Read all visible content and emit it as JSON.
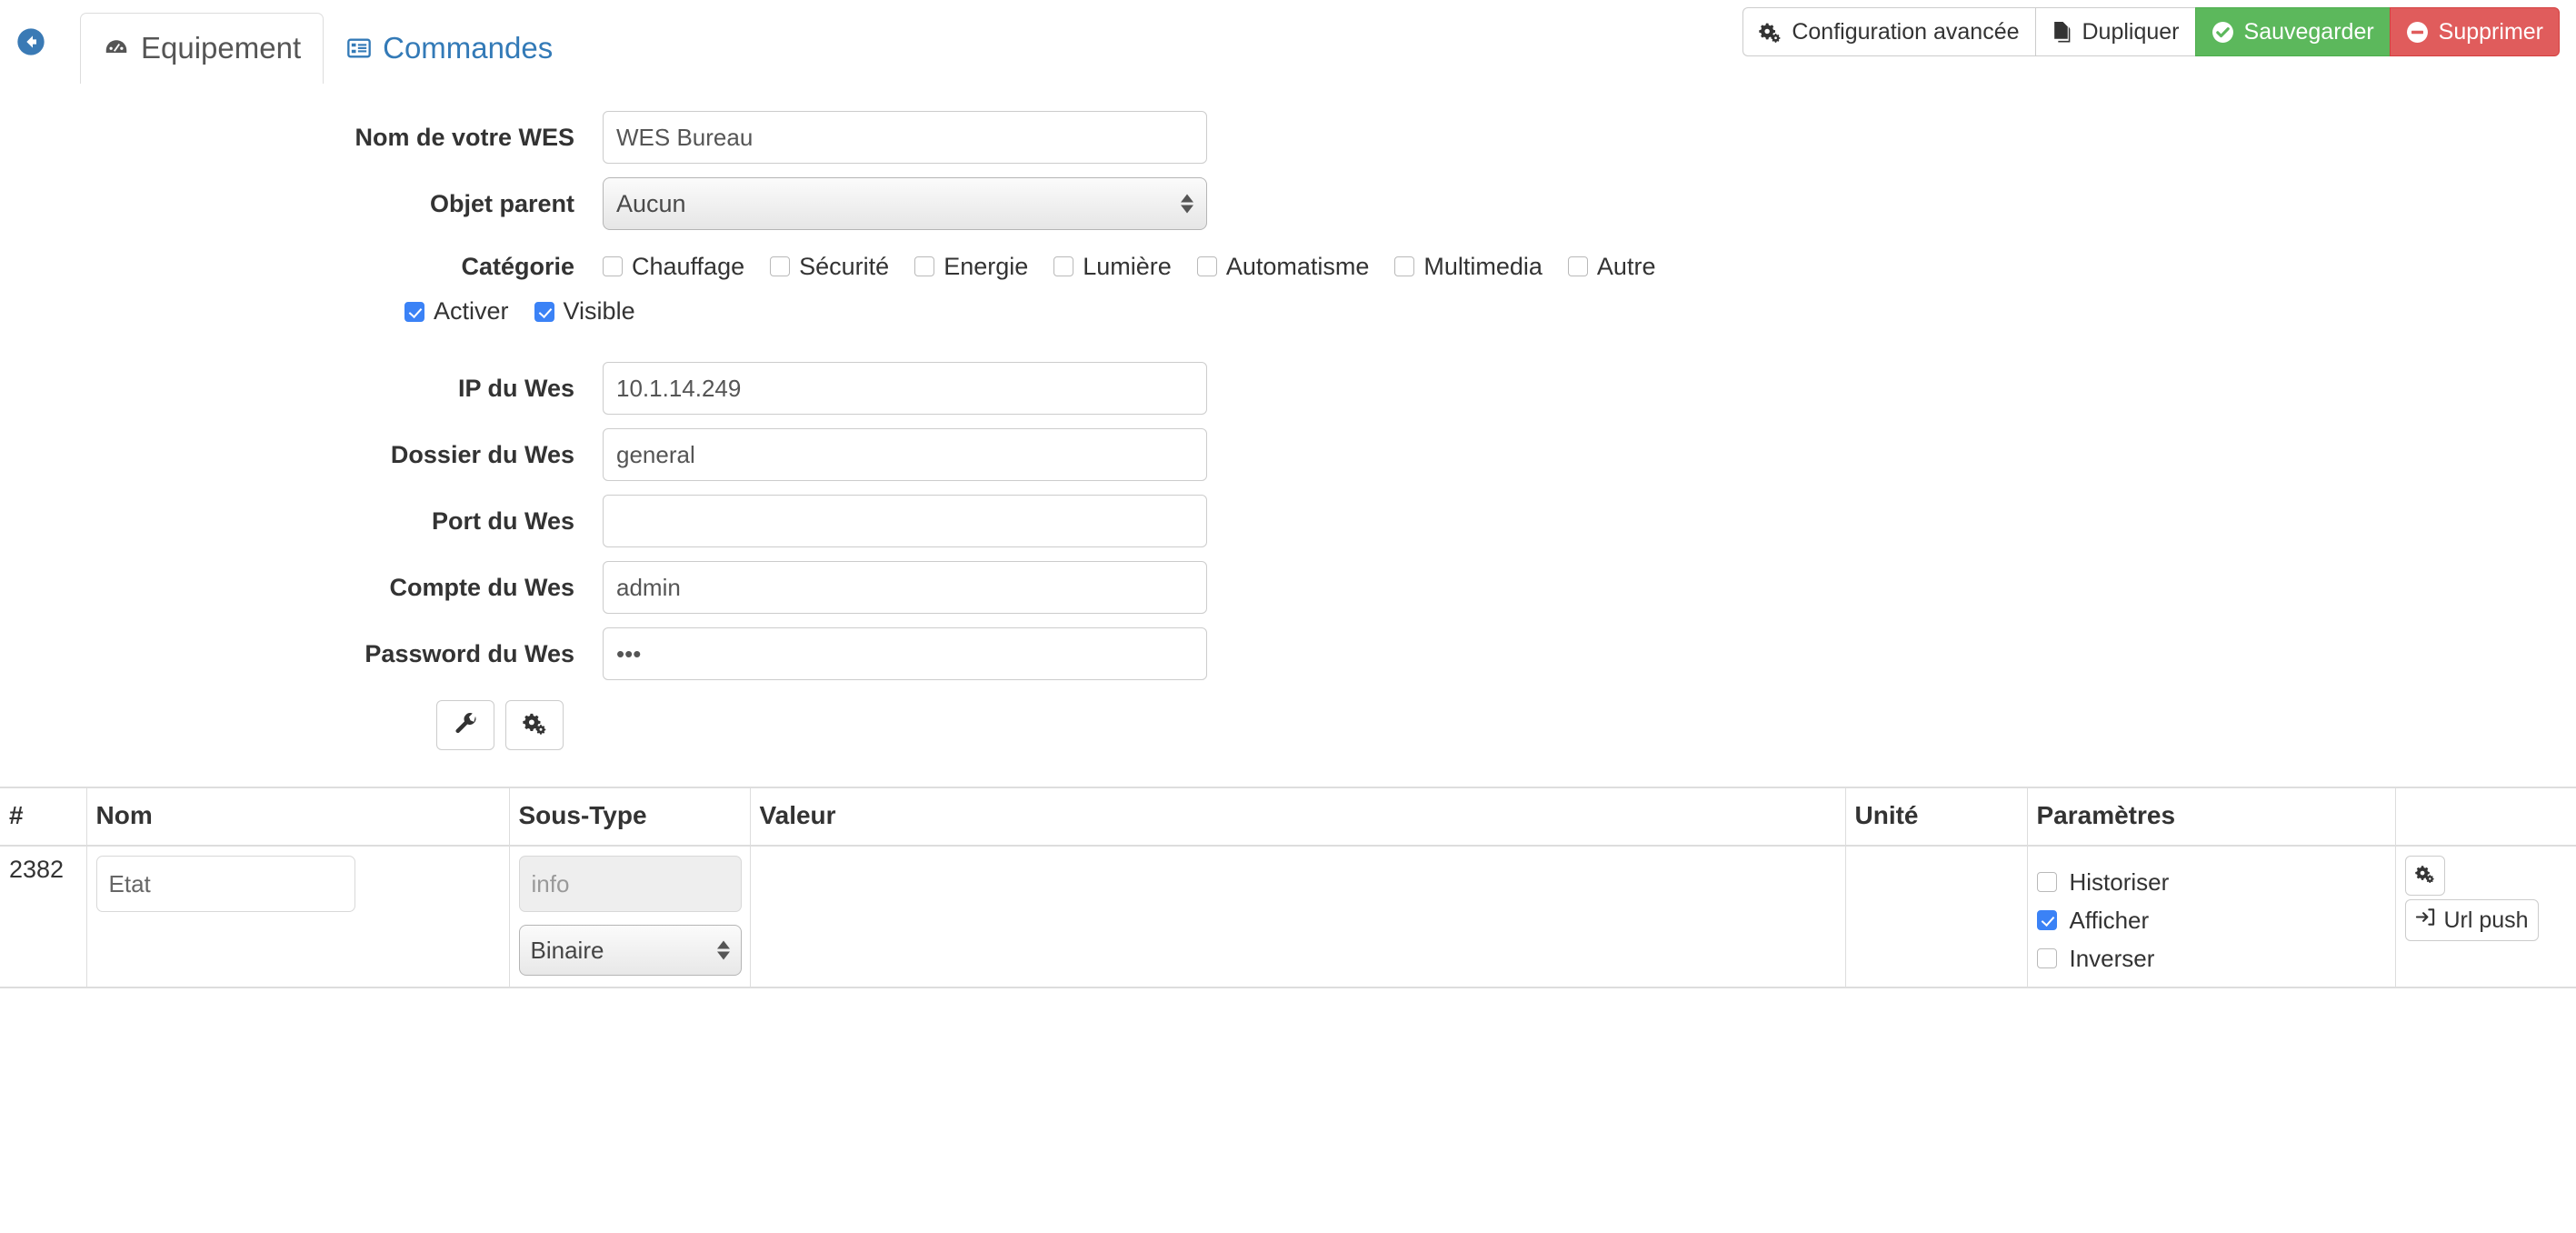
{
  "nav": {
    "back_icon": "back-circle-icon",
    "tabs": [
      {
        "label": "Equipement",
        "icon": "dashboard-icon",
        "active": true
      },
      {
        "label": "Commandes",
        "icon": "list-alt-icon",
        "active": false
      }
    ]
  },
  "toolbar": {
    "advanced_config_label": "Configuration avancée",
    "duplicate_label": "Dupliquer",
    "save_label": "Sauvegarder",
    "delete_label": "Supprimer",
    "save_color": "#5cb85c",
    "delete_color": "#e05c5c"
  },
  "form": {
    "name": {
      "label": "Nom de votre WES",
      "value": "WES Bureau",
      "placeholder": ""
    },
    "parent": {
      "label": "Objet parent",
      "value": "Aucun"
    },
    "category": {
      "label": "Catégorie",
      "options": [
        {
          "label": "Chauffage",
          "checked": false
        },
        {
          "label": "Sécurité",
          "checked": false
        },
        {
          "label": "Energie",
          "checked": false
        },
        {
          "label": "Lumière",
          "checked": false
        },
        {
          "label": "Automatisme",
          "checked": false
        },
        {
          "label": "Multimedia",
          "checked": false
        },
        {
          "label": "Autre",
          "checked": false
        }
      ]
    },
    "toggles": [
      {
        "label": "Activer",
        "checked": true
      },
      {
        "label": "Visible",
        "checked": true
      }
    ],
    "ip": {
      "label": "IP du Wes",
      "value": "10.1.14.249"
    },
    "folder": {
      "label": "Dossier du Wes",
      "value": "general"
    },
    "port": {
      "label": "Port du Wes",
      "value": ""
    },
    "account": {
      "label": "Compte du Wes",
      "value": "admin"
    },
    "password": {
      "label": "Password du Wes",
      "value": "•••"
    },
    "actions": [
      {
        "icon": "wrench-icon",
        "name": "wrench-button"
      },
      {
        "icon": "gears-icon",
        "name": "gears-button"
      }
    ]
  },
  "table": {
    "headers": [
      "#",
      "Nom",
      "Sous-Type",
      "Valeur",
      "Unité",
      "Paramètres",
      ""
    ],
    "rows": [
      {
        "id": "2382",
        "nom": {
          "value": "Etat",
          "placeholder": ""
        },
        "soustype_type": {
          "value": "",
          "placeholder": "info",
          "disabled": true
        },
        "soustype_select": "Binaire",
        "valeur": "",
        "unite": "",
        "params": [
          {
            "label": "Historiser",
            "checked": false
          },
          {
            "label": "Afficher",
            "checked": true
          },
          {
            "label": "Inverser",
            "checked": false
          }
        ],
        "actions": {
          "config_icon": "gears-icon",
          "urlpush_label": "Url push",
          "urlpush_icon": "sign-in-icon"
        }
      }
    ]
  },
  "colors": {
    "accent_blue": "#337ab7",
    "checkbox_blue": "#3b82f6",
    "border_grey": "#dddddd"
  }
}
